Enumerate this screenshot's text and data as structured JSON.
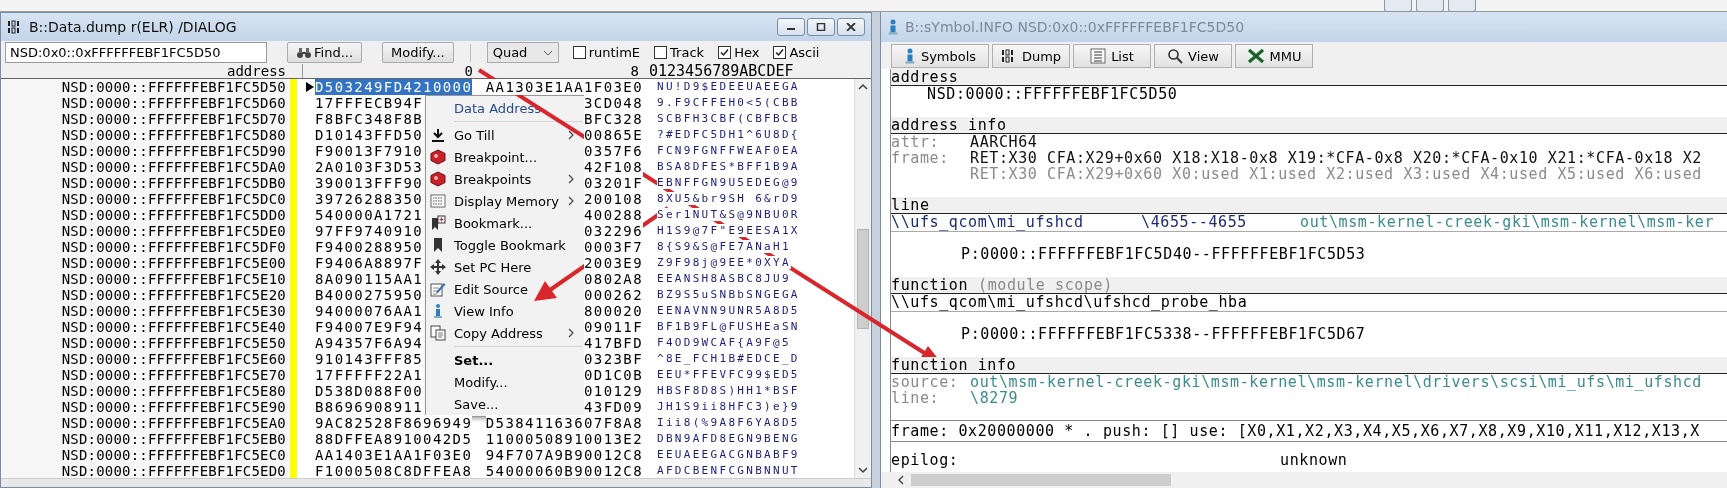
{
  "dump_window": {
    "title": "B::Data.dump r(ELR) /DIALOG",
    "address_field": {
      "value": "NSD:0x0::0xFFFFFFEBF1FC5D50"
    },
    "buttons": [
      "Find...",
      "Modify..."
    ],
    "width_select": {
      "value": "Quad"
    },
    "options": [
      {
        "label": "runtimE",
        "checked": false
      },
      {
        "label": "Track",
        "checked": false
      },
      {
        "label": "Hex",
        "checked": true
      },
      {
        "label": "Ascii",
        "checked": true
      }
    ],
    "columns": {
      "address": "address",
      "col_0": "0",
      "col_8": "8",
      "ascii": "0123456789ABCDEF"
    },
    "rows": [
      {
        "address": "NSD:0000::FFFFFFEBF1FC5D50",
        "col_0": "D503249FD4210000",
        "col_8": "AA1303E1AA1F03E0",
        "ascii": "NU!D9$EDEEUAEEGA",
        "selected": true
      },
      {
        "address": "NSD:0000::FFFFFFEBF1FC5D60",
        "col_0": "17FFFECB94F",
        "col_8": "3CD048",
        "ascii": "9.F9CFFEH0<5(CBB",
        "selected": false
      },
      {
        "address": "NSD:0000::FFFFFFEBF1FC5D70",
        "col_0": "F8BFC348F8B",
        "col_8": "BFC328",
        "ascii": "SCBFH3CBF(CBFBCB",
        "selected": false
      },
      {
        "address": "NSD:0000::FFFFFFEBF1FC5D80",
        "col_0": "D10143FFD50",
        "col_8": "00865E",
        "ascii": "?#EDFC5DH1^6U8D{",
        "selected": false
      },
      {
        "address": "NSD:0000::FFFFFFEBF1FC5D90",
        "col_0": "F90013F7910",
        "col_8": "0357F6",
        "ascii": "FCN9FGNFFWEAF0EA",
        "selected": false
      },
      {
        "address": "NSD:0000::FFFFFFEBF1FC5DA0",
        "col_0": "2A0103F3D53",
        "col_8": "42F108",
        "ascii": "BSA8DFES*BFF1B9A",
        "selected": false
      },
      {
        "address": "NSD:0000::FFFFFFEBF1FC5DB0",
        "col_0": "390013FFF90",
        "col_8": "03201F",
        "ascii": "EBNFFGN9U5EDEG@9",
        "selected": false
      },
      {
        "address": "NSD:0000::FFFFFFEBF1FC5DC0",
        "col_0": "39726288350",
        "col_8": "200108",
        "ascii": "8XU5&br9SH 6&rD9",
        "selected": false
      },
      {
        "address": "NSD:0000::FFFFFFEBF1FC5DD0",
        "col_0": "540000A1721",
        "col_8": "400288",
        "ascii": "Ser1NUT&S@9NBU0R",
        "selected": false
      },
      {
        "address": "NSD:0000::FFFFFFEBF1FC5DE0",
        "col_0": "97FF9740910",
        "col_8": "032296",
        "ascii": "H1S9@7F\"E9EESA1X",
        "selected": false
      },
      {
        "address": "NSD:0000::FFFFFFEBF1FC5DF0",
        "col_0": "F9400288950",
        "col_8": "0003F7",
        "ascii": "8{S9&S@FE7ANaH1",
        "selected": false
      },
      {
        "address": "NSD:0000::FFFFFFEBF1FC5E00",
        "col_0": "F9406A8897F",
        "col_8": "2003E9",
        "ascii": "Z9F98j@9EE*0XYA",
        "selected": false
      },
      {
        "address": "NSD:0000::FFFFFFEBF1FC5E10",
        "col_0": "8A090115AA1",
        "col_8": "0802A8",
        "ascii": "EEANSH8ASBC8JU9",
        "selected": false
      },
      {
        "address": "NSD:0000::FFFFFFEBF1FC5E20",
        "col_0": "B4000275950",
        "col_8": "000262",
        "ascii": "BZ9S5uSNBbSNGEGA",
        "selected": false
      },
      {
        "address": "NSD:0000::FFFFFFEBF1FC5E30",
        "col_0": "94000076AA1",
        "col_8": "800020",
        "ascii": "EENAVNN9UNR5A8D5",
        "selected": false
      },
      {
        "address": "NSD:0000::FFFFFFEBF1FC5E40",
        "col_0": "F94007E9F94",
        "col_8": "09011F",
        "ascii": "BF1B9FL@FUSHEaSN",
        "selected": false
      },
      {
        "address": "NSD:0000::FFFFFFEBF1FC5E50",
        "col_0": "A94357F6A94",
        "col_8": "417BFD",
        "ascii": "F4OD9WCAF{A9F@5",
        "selected": false
      },
      {
        "address": "NSD:0000::FFFFFFEBF1FC5E60",
        "col_0": "910143FFF85",
        "col_8": "0323BF",
        "ascii": "^8E_FCH1B#EDCE_D",
        "selected": false
      },
      {
        "address": "NSD:0000::FFFFFFEBF1FC5E70",
        "col_0": "17FFFFF22A1",
        "col_8": "0D1C0B",
        "ascii": "EEU*FFEVFC99$ED5",
        "selected": false
      },
      {
        "address": "NSD:0000::FFFFFFEBF1FC5E80",
        "col_0": "D538D088F00",
        "col_8": "010129",
        "ascii": "HBSF8D8S)HH1*BSF",
        "selected": false
      },
      {
        "address": "NSD:0000::FFFFFFEBF1FC5E90",
        "col_0": "B8696908911",
        "col_8": "43FD09",
        "ascii": "JH1S9ii8HFC3)e}9",
        "selected": false
      },
      {
        "address": "NSD:0000::FFFFFFEBF1FC5EA0",
        "col_0": "9AC82528F8696949",
        "col_8": "D53841163607F8A8",
        "ascii": "Iii8(%9A8F6YA8D5",
        "selected": false
      },
      {
        "address": "NSD:0000::FFFFFFEBF1FC5EB0",
        "col_0": "88DFFEA8910042D5",
        "col_8": "11000508910013E2",
        "ascii": "DBN9AFD8EGN9BENG",
        "selected": false
      },
      {
        "address": "NSD:0000::FFFFFFEBF1FC5EC0",
        "col_0": "AA1403E1AA1F03E0",
        "col_8": "94F707A9B90012C8",
        "ascii": "EEUAEEGACGNBABF9",
        "selected": false
      },
      {
        "address": "NSD:0000::FFFFFFEBF1FC5ED0",
        "col_0": "F1000508C8DFFEA8",
        "col_8": "54000060B90012C8",
        "ascii": "AFDCBENFCGNBNNUT",
        "selected": false
      }
    ]
  },
  "context_menu": {
    "items": [
      {
        "label": "Data Address",
        "kind": "header"
      },
      {
        "kind": "separator"
      },
      {
        "label": "Go Till",
        "kind": "action",
        "submenu": true
      },
      {
        "label": "Breakpoint...",
        "kind": "action",
        "submenu": false
      },
      {
        "label": "Breakpoints",
        "kind": "action",
        "submenu": true
      },
      {
        "label": "Display Memory",
        "kind": "action",
        "submenu": true
      },
      {
        "label": "Bookmark...",
        "kind": "action",
        "submenu": false
      },
      {
        "label": "Toggle Bookmark",
        "kind": "action",
        "submenu": false
      },
      {
        "label": "Set PC Here",
        "kind": "action",
        "submenu": false
      },
      {
        "label": "Edit Source",
        "kind": "action",
        "submenu": false
      },
      {
        "label": "View Info",
        "kind": "action",
        "submenu": false
      },
      {
        "label": "Copy Address",
        "kind": "action",
        "submenu": true
      },
      {
        "kind": "separator"
      },
      {
        "label": "Set...",
        "kind": "default"
      },
      {
        "label": "Modify...",
        "kind": "plain"
      },
      {
        "label": "Save...",
        "kind": "plain"
      }
    ]
  },
  "info_window": {
    "title": "B::sYmbol.INFO NSD:0x0::0xFFFFFFEBF1FC5D50",
    "tabs": [
      "Symbols",
      "Dump",
      "List",
      "View",
      "MMU"
    ],
    "sections": [
      {
        "heading": "address",
        "lines": [
          {
            "kind": "value",
            "text": "NSD:0000::FFFFFFEBF1FC5D50"
          }
        ]
      },
      {
        "heading": "address info",
        "lines": [
          {
            "kind": "field",
            "label": "attr:",
            "text": "AARCH64"
          },
          {
            "kind": "field",
            "label": "frame:",
            "text": "RET:X30 CFA:X29+0x60 X18:X18-0x8 X19:*CFA-0x8 X20:*CFA-0x10 X21:*CFA-0x18 X2"
          },
          {
            "kind": "continuation",
            "text": "RET:X30 CFA:X29+0x60 X0:used X1:used X2:used X3:used X4:used X5:used X6:used"
          }
        ]
      },
      {
        "heading": "line",
        "lines": [
          {
            "kind": "location",
            "module": "\\\\ufs_qcom\\mi_ufshcd",
            "range": "\\4655--4655",
            "file": "out\\msm-kernel-creek-gki\\msm-kernel\\msm-ker"
          },
          {
            "kind": "range",
            "text": "P:0000::FFFFFFEBF1FC5D40--FFFFFFEBF1FC5D53"
          }
        ]
      },
      {
        "heading": "function",
        "note": "(module scope)",
        "lines": [
          {
            "kind": "path",
            "text": "\\\\ufs_qcom\\mi_ufshcd\\ufshcd_probe_hba"
          },
          {
            "kind": "range",
            "text": "P:0000::FFFFFFEBF1FC5338--FFFFFFEBF1FC5D67"
          }
        ]
      },
      {
        "heading": "function info",
        "lines": [
          {
            "kind": "source",
            "label": "source:",
            "text": "out\\msm-kernel-creek-gki\\msm-kernel\\msm-kernel\\drivers\\scsi\\mi_ufs\\mi_ufshcd"
          },
          {
            "kind": "source",
            "label": "line:",
            "text": "\\8279"
          },
          {
            "kind": "summary",
            "text": "frame: 0x20000000 * . push: [] use: [X0,X1,X2,X3,X4,X5,X6,X7,X8,X9,X10,X11,X12,X13,X"
          },
          {
            "kind": "pair",
            "label": "epilog:",
            "text": "unknown"
          }
        ]
      }
    ]
  }
}
